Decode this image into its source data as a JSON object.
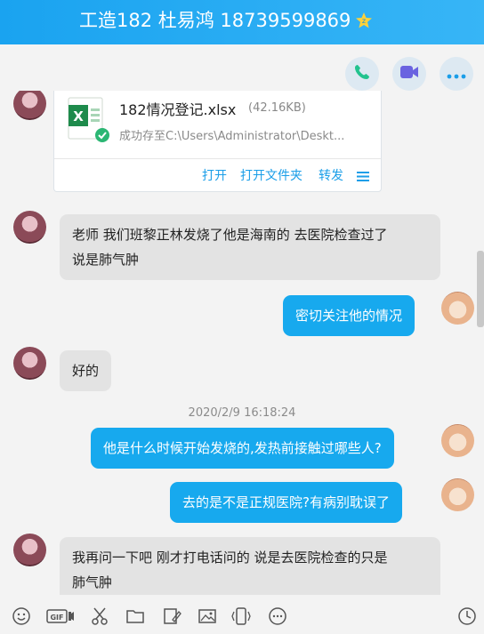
{
  "window": {
    "title": "工造182 杜易鸿 18739599869"
  },
  "toolbar": {
    "call_icon": "phone-icon",
    "video_icon": "video-icon",
    "more_icon": "more-icon"
  },
  "file": {
    "name": "182情况登记.xlsx",
    "size": "(42.16KB)",
    "status": "成功存至C:\\Users\\Administrator\\Deskt...",
    "actions": {
      "open": "打开",
      "open_folder": "打开文件夹",
      "forward": "转发"
    }
  },
  "messages": [
    {
      "from": "them",
      "text_line1": "老师 我们班黎正林发烧了他是海南的 去医院检查过了",
      "text_line2": "说是肺气肿"
    },
    {
      "from": "me",
      "text": "密切关注他的情况"
    },
    {
      "from": "them",
      "text": "好的"
    },
    {
      "timestamp": "2020/2/9 16:18:24"
    },
    {
      "from": "me",
      "text": "他是什么时候开始发烧的,发热前接触过哪些人?"
    },
    {
      "from": "me",
      "text": "去的是不是正规医院?有病别耽误了"
    },
    {
      "from": "them",
      "text_line1": "我再问一下吧 刚才打电话问的 说是去医院检查的只是",
      "text_line2": "肺气肿"
    }
  ],
  "bottom_tools": [
    "emoji-icon",
    "gif-icon",
    "scissors-icon",
    "folder-icon",
    "image-edit-icon",
    "image-icon",
    "shake-icon",
    "more-dots-icon",
    "history-icon"
  ],
  "colors": {
    "accent": "#17a9ee",
    "title_bg": "#1aa3f0"
  }
}
